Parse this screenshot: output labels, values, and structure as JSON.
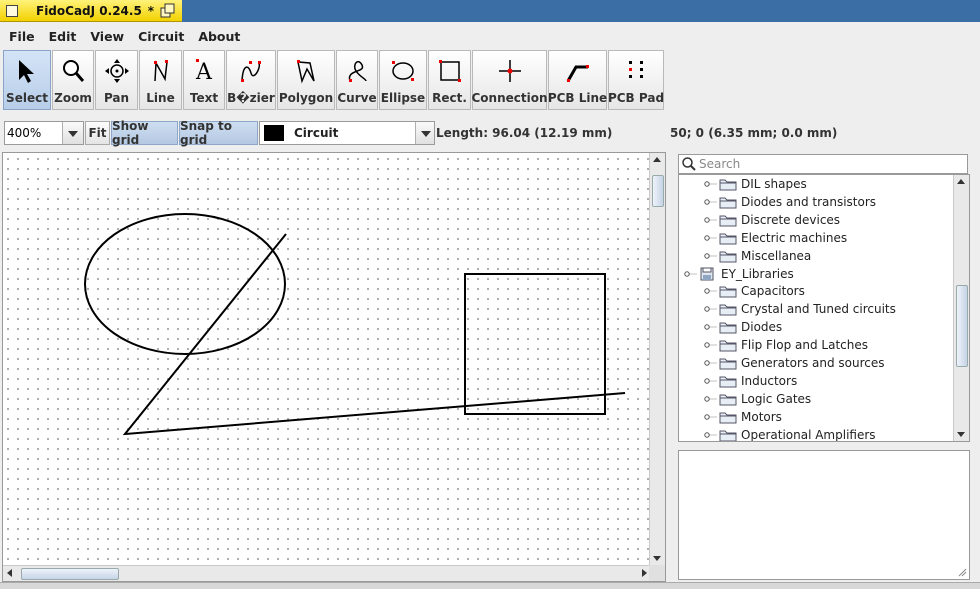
{
  "window": {
    "title": "FidoCadJ 0.24.5",
    "modified_marker": "*"
  },
  "menu": [
    "File",
    "Edit",
    "View",
    "Circuit",
    "About"
  ],
  "toolbar": {
    "tools": [
      {
        "id": "select",
        "label": "Select",
        "icon": "arrow-cursor-icon",
        "selected": true
      },
      {
        "id": "zoom",
        "label": "Zoom",
        "icon": "magnifier-icon"
      },
      {
        "id": "pan",
        "label": "Pan",
        "icon": "pan-arrows-icon"
      },
      {
        "id": "line",
        "label": "Line",
        "icon": "line-tool-icon"
      },
      {
        "id": "text",
        "label": "Text",
        "icon": "text-tool-icon"
      },
      {
        "id": "bezier",
        "label": "B�zier",
        "icon": "bezier-tool-icon"
      },
      {
        "id": "polygon",
        "label": "Polygon",
        "icon": "polygon-tool-icon"
      },
      {
        "id": "curve",
        "label": "Curve",
        "icon": "curve-tool-icon"
      },
      {
        "id": "ellipse",
        "label": "Ellipse",
        "icon": "ellipse-tool-icon"
      },
      {
        "id": "rect",
        "label": "Rect.",
        "icon": "rectangle-tool-icon"
      },
      {
        "id": "connection",
        "label": "Connection",
        "icon": "connection-tool-icon"
      },
      {
        "id": "pcbline",
        "label": "PCB Line",
        "icon": "pcb-line-tool-icon"
      },
      {
        "id": "pcbpad",
        "label": "PCB Pad",
        "icon": "pcb-pad-tool-icon"
      }
    ]
  },
  "options": {
    "zoom_value": "400%",
    "fit_label": "Fit",
    "show_grid_label": "Show grid",
    "show_grid_on": true,
    "snap_label": "Snap to grid",
    "snap_on": true,
    "layer_name": "Circuit",
    "layer_color": "#000000",
    "length_text": "Length: 96.04 (12.19 mm)",
    "coords_text": "50; 0 (6.35 mm; 0.0 mm)"
  },
  "library": {
    "search_placeholder": "Search",
    "rows": [
      {
        "label": "DIL shapes",
        "level": 2,
        "type": "folder"
      },
      {
        "label": "Diodes and transistors",
        "level": 2,
        "type": "folder"
      },
      {
        "label": "Discrete devices",
        "level": 2,
        "type": "folder"
      },
      {
        "label": "Electric machines",
        "level": 2,
        "type": "folder"
      },
      {
        "label": "Miscellanea",
        "level": 2,
        "type": "folder"
      },
      {
        "label": "EY_Libraries",
        "level": 1,
        "type": "library"
      },
      {
        "label": "Capacitors",
        "level": 2,
        "type": "folder"
      },
      {
        "label": "Crystal and Tuned circuits",
        "level": 2,
        "type": "folder"
      },
      {
        "label": "Diodes",
        "level": 2,
        "type": "folder"
      },
      {
        "label": "Flip Flop and Latches",
        "level": 2,
        "type": "folder"
      },
      {
        "label": "Generators and sources",
        "level": 2,
        "type": "folder"
      },
      {
        "label": "Inductors",
        "level": 2,
        "type": "folder"
      },
      {
        "label": "Logic Gates",
        "level": 2,
        "type": "folder"
      },
      {
        "label": "Motors",
        "level": 2,
        "type": "folder"
      },
      {
        "label": "Operational Amplifiers",
        "level": 2,
        "type": "folder"
      }
    ]
  },
  "colors": {
    "title_tab": "#f2d200",
    "desktop": "#3a6ea5",
    "selected_tool": "#b7cde8"
  }
}
